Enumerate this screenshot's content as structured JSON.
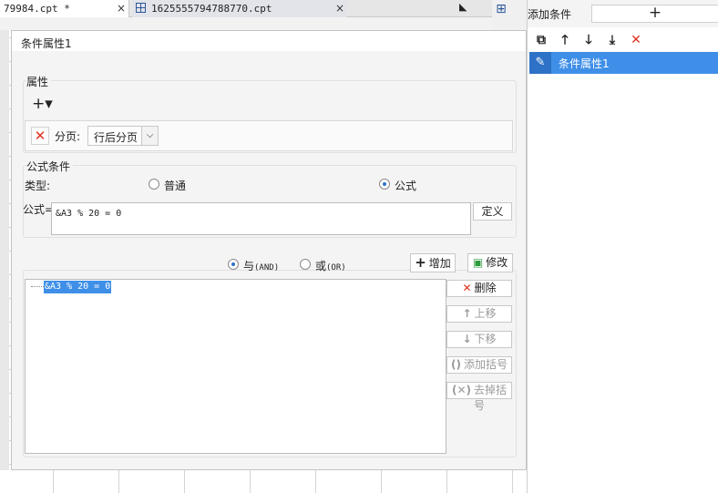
{
  "background": {
    "tabs": [
      {
        "label": "79984.cpt *",
        "close": "×"
      },
      {
        "label": "1625555794788770.cpt",
        "close": "×"
      }
    ]
  },
  "right_panel": {
    "title": "添加条件",
    "add_label": "+",
    "tools": [
      "copy-icon",
      "arrow-up-icon",
      "arrow-down-icon",
      "move-bottom-icon",
      "delete-icon"
    ],
    "items": [
      {
        "label": "条件属性1",
        "icon": "pencil-icon"
      }
    ]
  },
  "dialog": {
    "title": "条件属性1",
    "attributes": {
      "section_label": "属性",
      "add_label": "+▾",
      "row": {
        "delete_label": "✕",
        "name": "分页:",
        "select_value": "行后分页",
        "select_arrow": "⌵"
      }
    },
    "formula_condition": {
      "section_label": "公式条件",
      "type_label": "类型:",
      "options": [
        {
          "label": "普通",
          "selected": false
        },
        {
          "label": "公式",
          "selected": true
        }
      ],
      "formula_label": "公式=",
      "formula_value": "&A3 % 20 = 0",
      "define_label": "定义"
    },
    "logic": {
      "and_label": "与",
      "and_code": "(AND)",
      "or_label": "或",
      "or_code": "(OR)",
      "and_selected": true
    },
    "buttons": {
      "add": "增加",
      "modify": "修改",
      "delete": "删除",
      "move_up": "上移",
      "move_down": "下移",
      "add_bracket": "添加括号",
      "remove_bracket": "去掉括号"
    },
    "conditions": [
      "&A3 % 20 = 0"
    ]
  }
}
